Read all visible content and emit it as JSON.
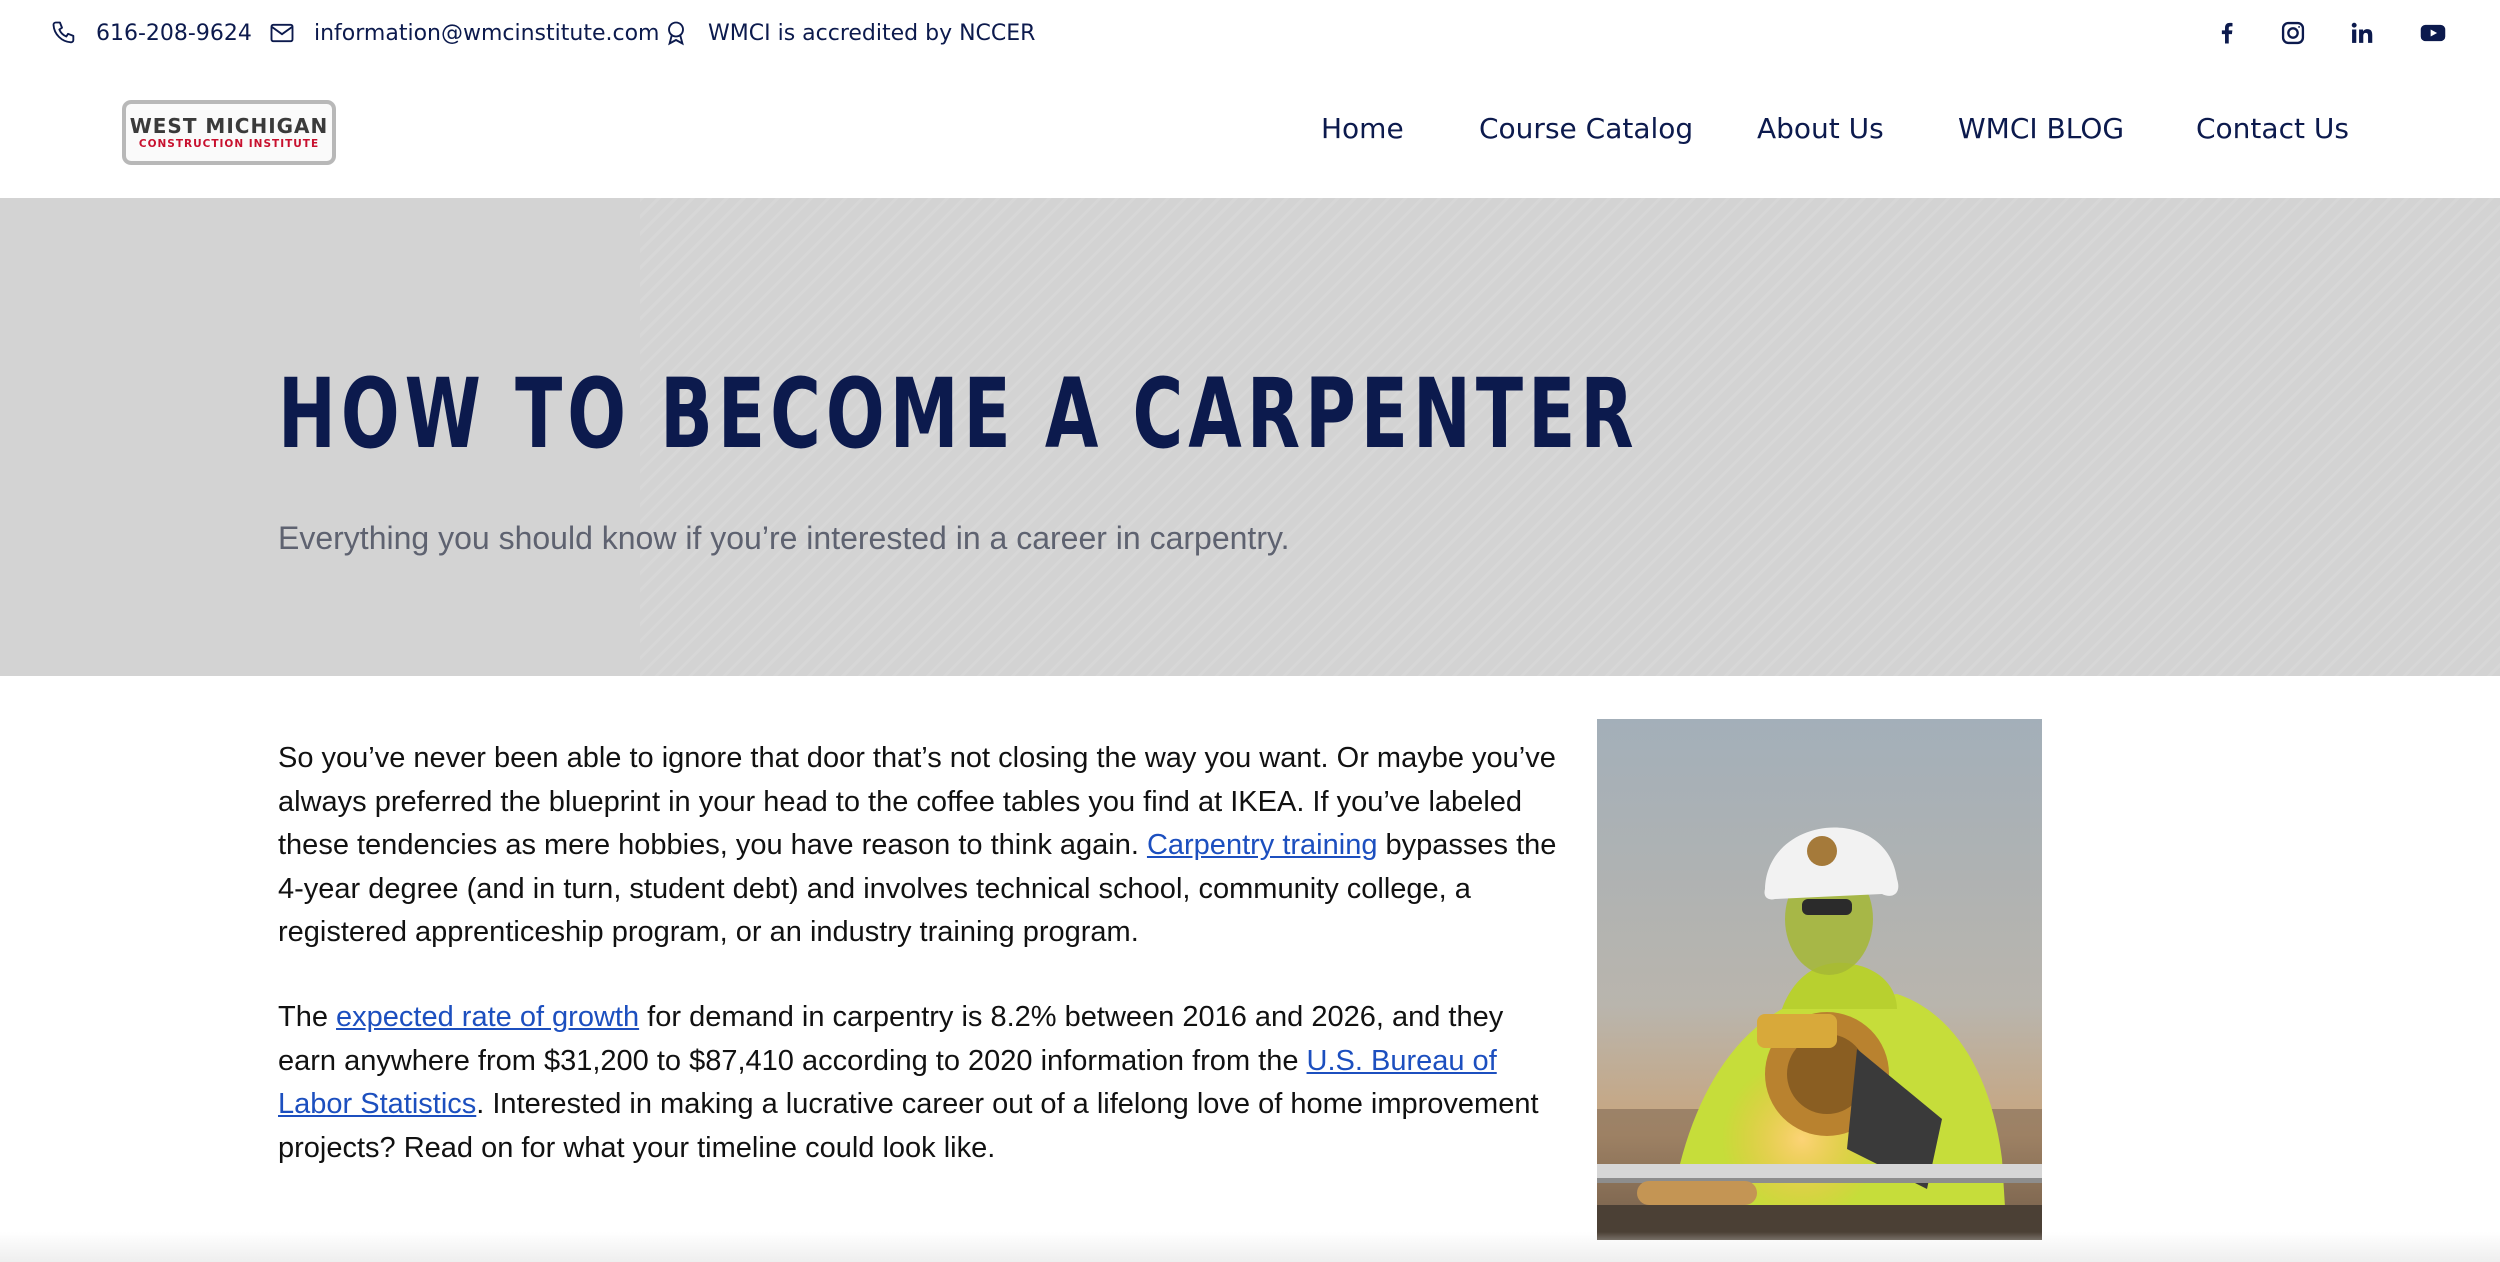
{
  "topbar": {
    "phone": "616-208-9624",
    "email": "information@wmcinstitute.com",
    "accreditation": "WMCI is accredited by NCCER",
    "icons": [
      "phone-icon",
      "mail-icon",
      "award-icon"
    ],
    "social": [
      "facebook-icon",
      "instagram-icon",
      "linkedin-icon",
      "youtube-icon"
    ]
  },
  "logo": {
    "line1": "WEST MICHIGAN",
    "line2": "CONSTRUCTION INSTITUTE"
  },
  "nav": {
    "items": [
      {
        "label": "Home"
      },
      {
        "label": "Course Catalog"
      },
      {
        "label": "About Us"
      },
      {
        "label": "WMCI BLOG"
      },
      {
        "label": "Contact Us"
      }
    ]
  },
  "hero": {
    "title": "HOW TO BECOME A CARPENTER",
    "subtitle": "Everything you should know if you’re interested in a career in carpentry."
  },
  "article": {
    "p1": {
      "text1": "So you’ve never been able to ignore that door that’s not closing the way you want. Or maybe you’ve always preferred the blueprint in your head to the coffee tables you find at IKEA. If you’ve labeled these tendencies as mere hobbies, you have reason to think again. ",
      "link1": "Carpentry training",
      "text2": " bypasses the 4-year degree (and in turn, student debt) and involves technical school, community college, a registered apprenticeship program, or an industry training program."
    },
    "p2": {
      "text1": "The ",
      "link1": "expected rate of growth",
      "text2": " for demand in carpentry is 8.2% between 2016 and 2026, and they earn anywhere from $31,200 to $87,410 according to 2020 information from the ",
      "link2": "U.S. Bureau of Labor Statistics",
      "text3": ". Interested in making a lucrative career out of a lifelong love of home improvement projects? Read on for what your timeline could look like."
    }
  },
  "colors": {
    "navy": "#0c1a4d",
    "link": "#1c4fbf",
    "hero_bg": "#d3d3d3",
    "subtitle": "#5e6270",
    "logo_red": "#c8102e"
  }
}
